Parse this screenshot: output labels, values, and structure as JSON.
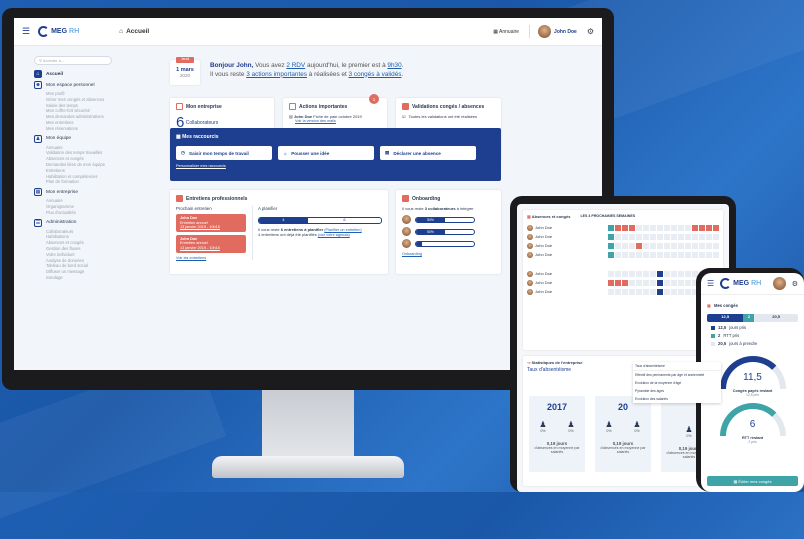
{
  "brand": {
    "meg": "MEG",
    "rh": "RH"
  },
  "topbar": {
    "home": "Accueil",
    "annuaire": "Annuaire",
    "user": "John Doe"
  },
  "sidebar": {
    "search_placeholder": "Accéder à...",
    "home": "Accueil",
    "perso": {
      "title": "Mon espace personnel",
      "items": [
        "Mon profil",
        "Gérer mes congés et absences",
        "Saisie des temps",
        "Mon coffre-fort sécurisé",
        "Mes demandes administratives",
        "Mes entretiens",
        "Mes réservations"
      ]
    },
    "equipe": {
      "title": "Mon équipe",
      "items": [
        "Annuaire",
        "Validation des temps travaillés",
        "Absences et congés",
        "Demandes liées de mon équipe",
        "Entretiens",
        "Habilitation et compétences",
        "Plan de formation"
      ]
    },
    "entreprise": {
      "title": "Mon entreprise",
      "items": [
        "Annuaire",
        "Organigramme",
        "Flux d'actualités"
      ]
    },
    "admin": {
      "title": "Administration",
      "items": [
        "Collaborateurs",
        "Habilitations",
        "Absences et congés",
        "Gestion des fluxes",
        "Votre individuel",
        "Analyse de données",
        "Tableau de bord social",
        "Diffuser un message",
        "Sondage"
      ]
    }
  },
  "date": {
    "tag": "Jeudi",
    "day": "1 mars",
    "year": "2020"
  },
  "greeting": {
    "hello": "Bonjour John,",
    "t1": " Vous avez ",
    "rdv": "2 RDV",
    "t2": " aujourd'hui, le premier est à ",
    "time": "9h30",
    "t3": ".",
    "t4": "Il vous reste ",
    "actions": "3 actions importantes",
    "t5": " à réalisées et ",
    "conges": "3 congés à validés",
    "t6": "."
  },
  "entreprise_card": {
    "title": "Mon entreprise",
    "count1": "6",
    "label1": "Collaborateurs",
    "count2": "4",
    "label2": "ayant accès au logiciel",
    "link1": "Onboarding",
    "link2": "Offboarding"
  },
  "actions_card": {
    "title": "Actions importantes",
    "badge": "1",
    "name": "John Doe",
    "text": "Fiche de paie octobre 2019",
    "link": "Voir la version des mails"
  },
  "validations_card": {
    "title": "Validations congés / absences",
    "text": "Toutes les validations ont été réalisées"
  },
  "shortcuts": {
    "title": "Mes raccourcis",
    "b1": "Saisir mon temps de travail",
    "b2": "Pousser une idée",
    "b3": "Déclarer une absence",
    "link": "Personnaliser mes raccourcis"
  },
  "entretiens": {
    "title": "Entretiens professionnels",
    "col1": "Prochain entretien",
    "col2": "A planifier",
    "e1_name": "John Doe",
    "e1_type": "Entretien annuel",
    "e1_date": "13 janvier 2019 - 10h15",
    "e2_name": "John Doe",
    "e2_type": "Entretien annuel",
    "e2_date": "13 janvier 2019 - 10h15",
    "bar1": "4",
    "bar2": "6",
    "t1": "Il vous reste ",
    "t1b": "6 entretiens à planifier",
    "t1link": "(Planifier un entretien)",
    "t2": "4 entretiens ont déjà été planifiés ",
    "t2link": "(voir votre agenda)",
    "link": "Voir les entretiens"
  },
  "onboarding": {
    "title": "Onboarding",
    "text1": "Il vous reste ",
    "text2": "3 collaborateurs",
    "text3": " à intégrer",
    "p1": "50%",
    "p2": "50%",
    "p3": "10%",
    "progress": [
      0.5,
      0.5,
      0.1
    ],
    "link": "Onboarding"
  },
  "tablet": {
    "absences_title": "Absences et congés",
    "weeks_label": "LES 4 PROCHAINES SEMAINES",
    "names": [
      "John Doe",
      "John Doe",
      "John Doe",
      "John Doe",
      "John Doe",
      "John Doe",
      "John Doe"
    ],
    "stats_title": "Statistiques de l'entreprise",
    "stats_sub": "Taux d'absentéisme",
    "dropdown": [
      "Taux d'absentéisme",
      "Effectif des permanents par âge et ancienneté",
      "Evolution de la moyenne d'âge",
      "Pyramide des âges",
      "Evolution des salariés"
    ],
    "col1_year": "2017",
    "col1_pct_a": "0%",
    "col1_pct_b": "0%",
    "col1_days": "0,19 jours",
    "col1_caption": "d'absences en moyenne par salariés",
    "col2_year": "20",
    "col2_pct_a": "0%",
    "col2_pct_b": "0%",
    "col2_days": "0,19 jours",
    "col2_caption": "d'absences en moyenne par salariés",
    "col3_pct_a": "0%",
    "col3_days": "0,19 jours",
    "col3_caption": "d'absences en moyenne par salariés"
  },
  "phone": {
    "title": "Mes congés",
    "seg1": "12,5",
    "seg2": "2",
    "seg3": "20,5",
    "l1_num": "12,5",
    "l1_txt": " jours pris",
    "l2_num": "2",
    "l2_txt": " RTT pris",
    "l3_num": "20,5",
    "l3_txt": " jours à prendre",
    "g1_val": "11,5",
    "g1_label": "Congés payés restant",
    "g1_sub": "12,5 pris",
    "g2_val": "6",
    "g2_label": "RTT restant",
    "g2_sub": "2 pris",
    "button": "Éditer mes congés"
  },
  "colors": {
    "primary": "#1e3f8f",
    "accent": "#3fa4a8",
    "alert": "#e26b60"
  }
}
